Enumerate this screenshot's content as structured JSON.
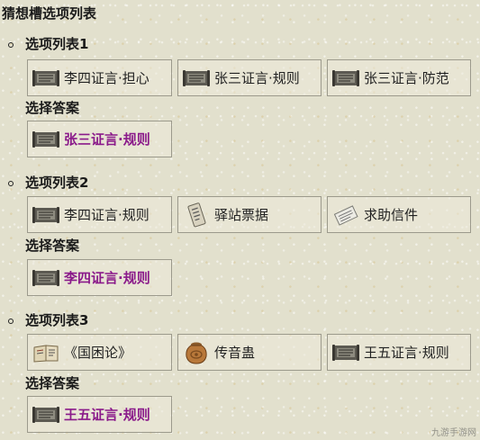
{
  "page_title": "猜想槽选项列表",
  "groups": [
    {
      "title": "选项列表1",
      "options": [
        {
          "label": "李四证言·担心",
          "icon": "testimony-scroll-icon"
        },
        {
          "label": "张三证言·规则",
          "icon": "testimony-scroll-icon"
        },
        {
          "label": "张三证言·防范",
          "icon": "testimony-scroll-icon"
        }
      ],
      "answer_title": "选择答案",
      "answer": {
        "label": "张三证言·规则",
        "icon": "testimony-scroll-icon"
      }
    },
    {
      "title": "选项列表2",
      "options": [
        {
          "label": "李四证言·规则",
          "icon": "testimony-scroll-icon"
        },
        {
          "label": "驿站票据",
          "icon": "receipt-icon"
        },
        {
          "label": "求助信件",
          "icon": "letter-icon"
        }
      ],
      "answer_title": "选择答案",
      "answer": {
        "label": "李四证言·规则",
        "icon": "testimony-scroll-icon"
      }
    },
    {
      "title": "选项列表3",
      "options": [
        {
          "label": "《国困论》",
          "icon": "open-book-icon"
        },
        {
          "label": "传音蛊",
          "icon": "gu-jar-icon"
        },
        {
          "label": "王五证言·规则",
          "icon": "testimony-scroll-icon"
        }
      ],
      "answer_title": "选择答案",
      "answer": {
        "label": "王五证言·规则",
        "icon": "testimony-scroll-icon"
      }
    }
  ],
  "watermark": "九游手游网",
  "colors": {
    "background": "#e2e0cd",
    "answer_text": "#8a1a8a",
    "border": "#9c9a8c"
  }
}
